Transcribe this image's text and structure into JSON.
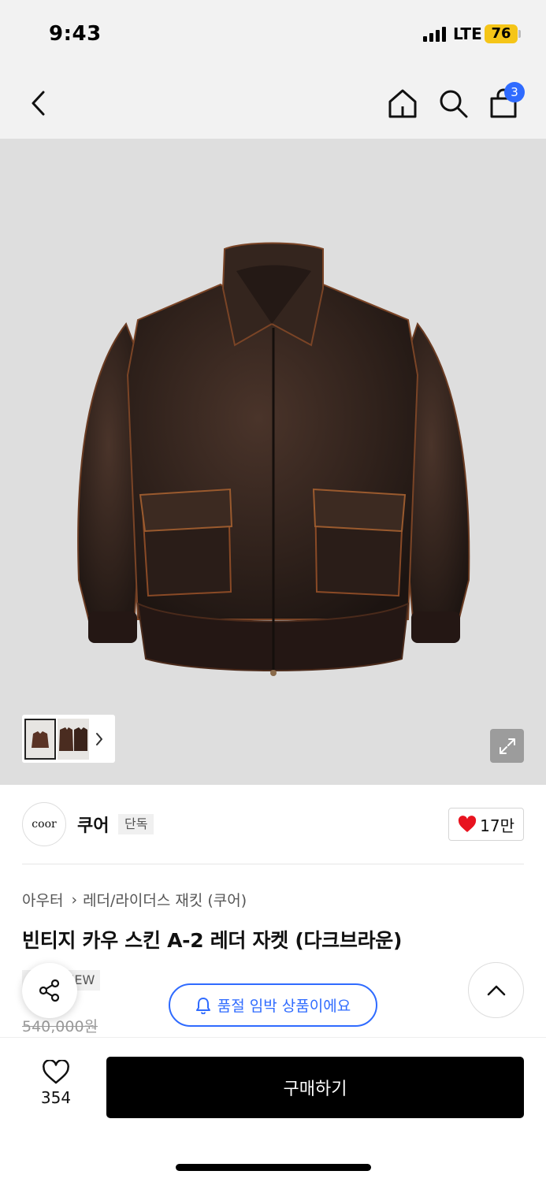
{
  "status_bar": {
    "time": "9:43",
    "network": "LTE",
    "battery": "76"
  },
  "header": {
    "cart_count": "3"
  },
  "gallery": {
    "thumbnails": [
      "jacket-front",
      "jacket-pair"
    ]
  },
  "brand": {
    "logo_text": "coor",
    "name": "쿠어",
    "tag": "단독",
    "likes": "17만"
  },
  "product": {
    "breadcrumb": [
      "아우터",
      "레더/라이더스 재킷 (쿠어)"
    ],
    "title": "빈티지 카우 스킨 A-2 레더 자켓 (다크브라운)",
    "tags": [
      "단독",
      "NEW"
    ],
    "original_price": "540,000원"
  },
  "soldout_notice": "품절 임박 상품이에요",
  "bottom": {
    "wish_count": "354",
    "buy_label": "구매하기"
  },
  "colors": {
    "accent": "#2f6bff",
    "heart": "#e8131f",
    "buy": "#000000"
  }
}
